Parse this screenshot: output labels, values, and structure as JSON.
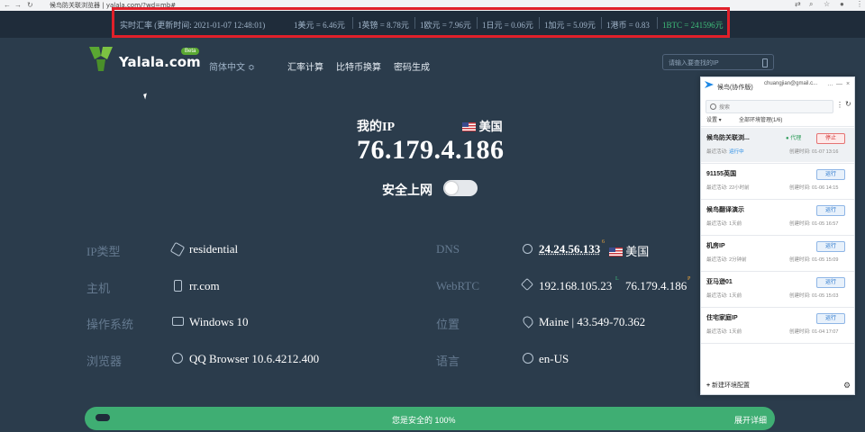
{
  "browser": {
    "tab_title": "候鸟防关联浏览器",
    "url": "yalala.com/?wd=mb#",
    "nav": [
      "←",
      "→",
      "↻"
    ],
    "right_icons": [
      "translate-icon",
      "zoom-icon",
      "star-icon",
      "account-icon",
      "menu-icon"
    ]
  },
  "rates": {
    "label": "实时汇率 (更新时间: 2021-01-07 12:48:01)",
    "items": [
      "1美元 = 6.46元",
      "1英镑 = 8.78元",
      "1欧元 = 7.96元",
      "1日元 = 0.06元",
      "1加元 = 5.09元",
      "1港币 = 0.83",
      "1BTC = 241596元"
    ],
    "btc_color": "#3fbf7a"
  },
  "header": {
    "logo": "Yalala.com",
    "beta": "Beta",
    "lang": "简体中文 ≎",
    "menu": [
      "汇率计算",
      "比特币换算",
      "密码生成"
    ],
    "search_placeholder": "请输入要查找的IP"
  },
  "ipcard": {
    "my_ip_label": "我的IP",
    "country": "美国",
    "ip": "76.179.4.186",
    "safe_label": "安全上网"
  },
  "details": {
    "ip_type_label": "IP类型",
    "ip_type": "residential",
    "host_label": "主机",
    "host": "rr.com",
    "os_label": "操作系统",
    "os": "Windows 10",
    "browser_label": "浏览器",
    "browser": "QQ Browser 10.6.4212.400",
    "dns_label": "DNS",
    "dns": "24.24.56.133",
    "dns_sup": "6",
    "dns_country": "美国",
    "webrtc_label": "WebRTC",
    "webrtc_local": "192.168.105.23",
    "webrtc_local_sup": "L",
    "webrtc_public": "76.179.4.186",
    "webrtc_public_sup": "P",
    "location_label": "位置",
    "location": "Maine | 43.549-70.362",
    "language_label": "语言",
    "language": "en-US"
  },
  "bottom": {
    "status": "您是安全的 100%",
    "more": "展开详细"
  },
  "panel": {
    "title": "候鸟(协作版)",
    "email": "chuangjian@gmail.c...",
    "window_controls": [
      "…",
      "—",
      "×"
    ],
    "search_placeholder": "搜索",
    "settings": "设置 ▾",
    "env_manage": "全部环境管理(1/6)",
    "items": [
      {
        "name": "候鸟防关联浏...",
        "status_label": "最近活动:",
        "status": "运行中",
        "created": "创建时间: 01-07 13:16",
        "proxy": "● 代理",
        "btn": "停止",
        "stop": true
      },
      {
        "name": "91155英国",
        "status_label": "最近活动:",
        "status": "22小时前",
        "created": "创建时间: 01-06 14:15",
        "btn": "运行"
      },
      {
        "name": "候鸟翻译演示",
        "status_label": "最近活动:",
        "status": "1天前",
        "created": "创建时间: 01-05 16:57",
        "btn": "运行"
      },
      {
        "name": "机房IP",
        "status_label": "最近活动:",
        "status": "2分钟前",
        "created": "创建时间: 01-05 15:09",
        "btn": "运行"
      },
      {
        "name": "亚马逊01",
        "status_label": "最近活动:",
        "status": "1天前",
        "created": "创建时间: 01-05 15:03",
        "btn": "运行"
      },
      {
        "name": "住宅家庭IP",
        "status_label": "最近活动:",
        "status": "1天前",
        "created": "创建时间: 01-04 17:07",
        "btn": "运行"
      }
    ],
    "new_env": "新建环境配置"
  }
}
